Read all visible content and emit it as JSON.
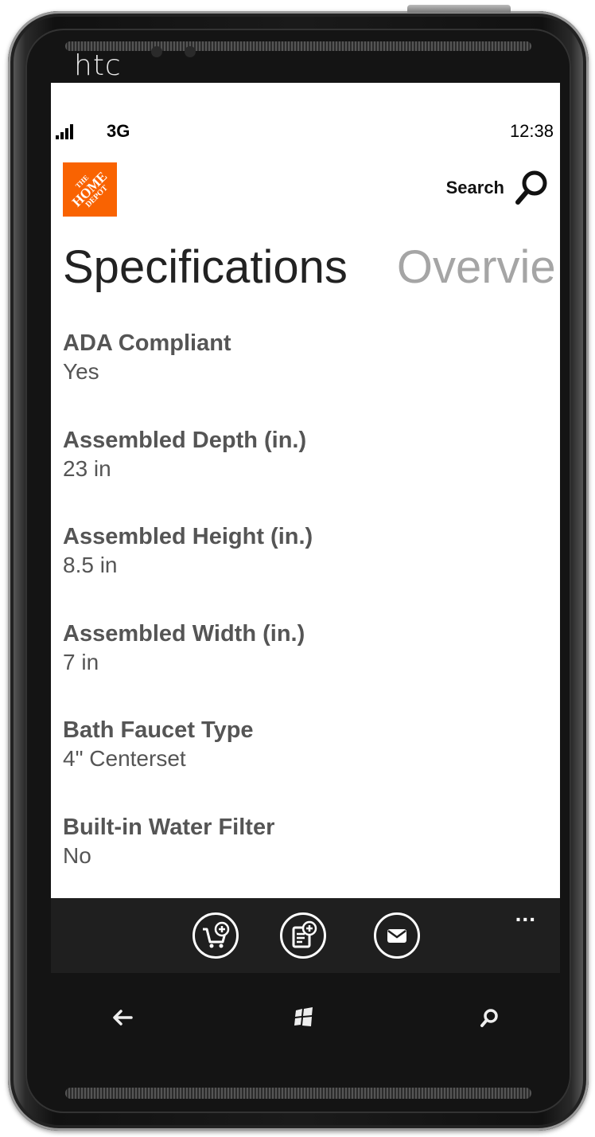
{
  "device": {
    "brand": "htc"
  },
  "status_bar": {
    "network": "3G",
    "time": "12:38",
    "signal_bars": 4
  },
  "header": {
    "logo": {
      "name": "home-depot-logo",
      "lines": [
        "THE",
        "HOME",
        "DEPOT"
      ],
      "color": "#f96302"
    },
    "search_label": "Search"
  },
  "pivot": {
    "active": "Specifications",
    "next": "Overvie"
  },
  "specs": [
    {
      "name": "ADA Compliant",
      "value": "Yes"
    },
    {
      "name": "Assembled Depth (in.)",
      "value": "23 in"
    },
    {
      "name": "Assembled Height (in.)",
      "value": "8.5 in"
    },
    {
      "name": "Assembled Width (in.)",
      "value": "7 in"
    },
    {
      "name": "Bath Faucet Type",
      "value": "4\" Centerset"
    },
    {
      "name": "Built-in Water Filter",
      "value": "No"
    }
  ],
  "app_bar": {
    "buttons": [
      "add-to-cart-icon",
      "add-to-list-icon",
      "email-icon"
    ],
    "more": "..."
  },
  "hardware_keys": [
    "back-icon",
    "windows-start-icon",
    "search-icon"
  ]
}
